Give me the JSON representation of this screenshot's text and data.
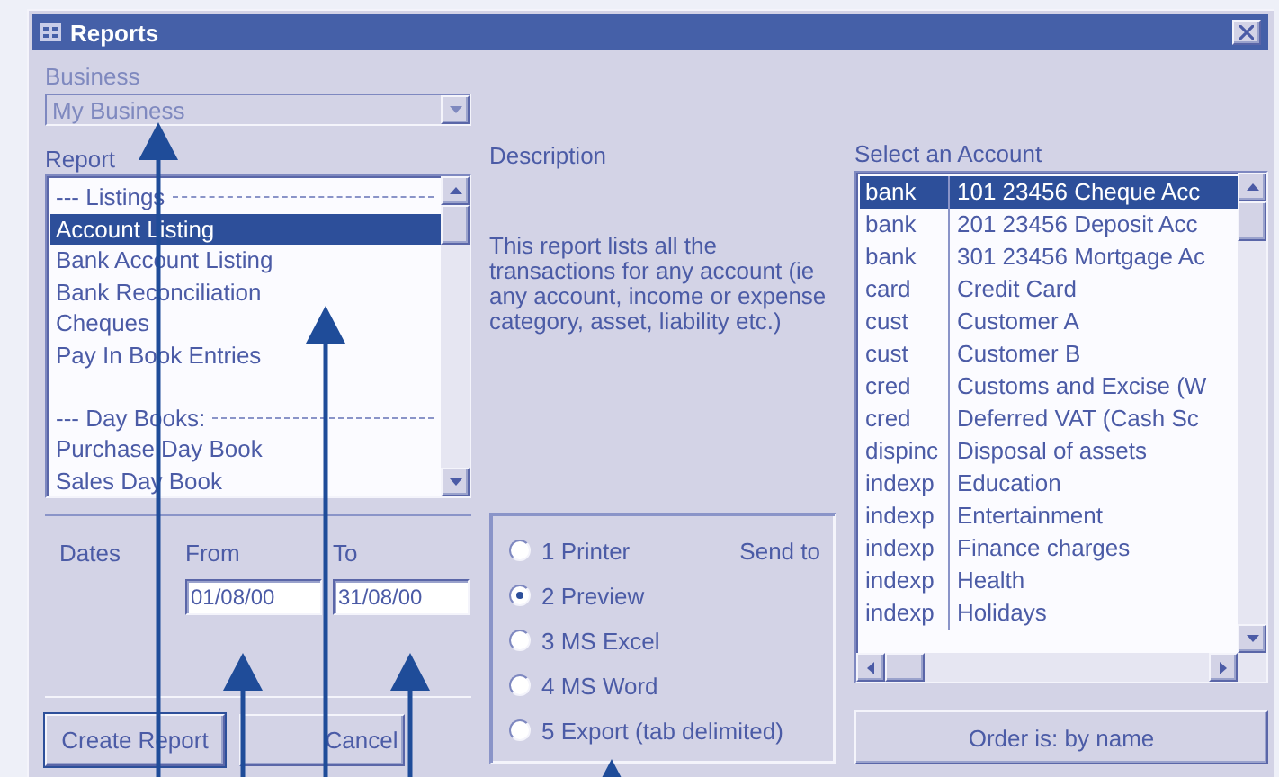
{
  "window": {
    "title": "Reports"
  },
  "business": {
    "label": "Business",
    "value": "My Business",
    "disabled": true
  },
  "report": {
    "label": "Report",
    "items": [
      {
        "kind": "header",
        "text": "--- Listings",
        "selected": false
      },
      {
        "kind": "item",
        "text": "Account Listing",
        "selected": true
      },
      {
        "kind": "item",
        "text": "Bank Account Listing",
        "selected": false
      },
      {
        "kind": "item",
        "text": "Bank Reconciliation",
        "selected": false
      },
      {
        "kind": "item",
        "text": "Cheques",
        "selected": false
      },
      {
        "kind": "item",
        "text": "Pay In Book Entries",
        "selected": false
      },
      {
        "kind": "blank",
        "selected": false
      },
      {
        "kind": "header",
        "text": "--- Day Books:",
        "selected": false
      },
      {
        "kind": "item",
        "text": "Purchase Day Book",
        "selected": false
      },
      {
        "kind": "item",
        "text": "Sales Day Book",
        "selected": false
      }
    ]
  },
  "description": {
    "label": "Description",
    "text": "This report lists all the transactions for any account (ie any account, income or expense category, asset, liability etc.)"
  },
  "dates": {
    "label": "Dates",
    "from": {
      "label": "From",
      "value": "01/08/00"
    },
    "to": {
      "label": "To",
      "value": "31/08/00"
    }
  },
  "send_to": {
    "label": "Send to",
    "options": [
      {
        "label": "1 Printer",
        "selected": false
      },
      {
        "label": "2 Preview",
        "selected": true
      },
      {
        "label": "3 MS Excel",
        "selected": false
      },
      {
        "label": "4 MS Word",
        "selected": false
      },
      {
        "label": "5 Export (tab delimited)",
        "selected": false
      }
    ]
  },
  "accounts": {
    "label": "Select an Account",
    "rows": [
      {
        "type": "bank",
        "name": "101 23456 Cheque Acc",
        "selected": true
      },
      {
        "type": "bank",
        "name": "201 23456 Deposit Acc",
        "selected": false
      },
      {
        "type": "bank",
        "name": "301 23456 Mortgage Ac",
        "selected": false
      },
      {
        "type": "card",
        "name": "Credit Card",
        "selected": false
      },
      {
        "type": "cust",
        "name": "Customer A",
        "selected": false
      },
      {
        "type": "cust",
        "name": "Customer B",
        "selected": false
      },
      {
        "type": "cred",
        "name": "Customs and Excise (W",
        "selected": false
      },
      {
        "type": "cred",
        "name": "Deferred VAT (Cash Sc",
        "selected": false
      },
      {
        "type": "dispinc",
        "name": "Disposal of assets",
        "selected": false
      },
      {
        "type": "indexp",
        "name": "Education",
        "selected": false
      },
      {
        "type": "indexp",
        "name": "Entertainment",
        "selected": false
      },
      {
        "type": "indexp",
        "name": "Finance charges",
        "selected": false
      },
      {
        "type": "indexp",
        "name": "Health",
        "selected": false
      },
      {
        "type": "indexp",
        "name": "Holidays",
        "selected": false
      }
    ]
  },
  "buttons": [
    {
      "label": "Create Report",
      "default": true
    },
    {
      "label": "Cancel",
      "default": false
    }
  ],
  "order_button": {
    "label": "Order is: by name"
  }
}
